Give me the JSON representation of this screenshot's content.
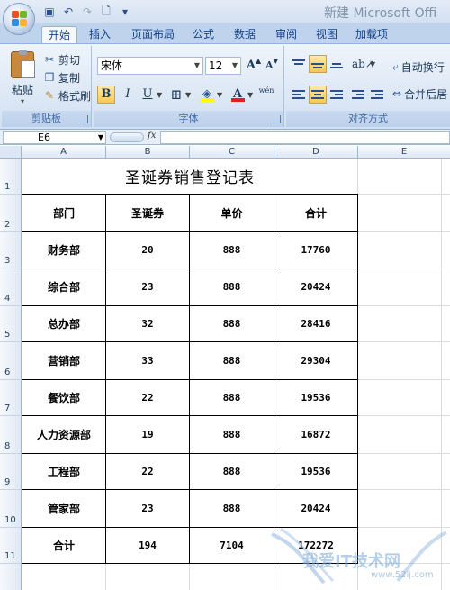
{
  "window": {
    "title": "新建 Microsoft Offi",
    "qat": [
      {
        "icon": "save-icon",
        "glyph": "▣"
      },
      {
        "icon": "undo-icon",
        "glyph": "↶"
      },
      {
        "icon": "redo-icon",
        "glyph": "↷"
      },
      {
        "icon": "print-preview-icon",
        "glyph": "🗋"
      },
      {
        "icon": "customize-qat-icon",
        "glyph": "▾"
      }
    ]
  },
  "ribbon": {
    "tabs": [
      "开始",
      "插入",
      "页面布局",
      "公式",
      "数据",
      "审阅",
      "视图",
      "加载项"
    ],
    "active_tab": "开始",
    "clipboard": {
      "paste": "粘贴",
      "cut": "剪切",
      "copy": "复制",
      "format_painter": "格式刷",
      "group_label": "剪贴板"
    },
    "font": {
      "name": "宋体",
      "size": "12",
      "grow": "A",
      "shrink": "A",
      "bold": "B",
      "italic": "I",
      "underline": "U",
      "font_color_letter": "A",
      "phonetic": "wén",
      "group_label": "字体"
    },
    "alignment": {
      "wrap_text": "自动换行",
      "merge_center": "合并后居",
      "group_label": "对齐方式"
    }
  },
  "formula_bar": {
    "name_box": "E6",
    "fx": "fx",
    "formula": ""
  },
  "grid": {
    "columns": [
      "A",
      "B",
      "C",
      "D",
      "E"
    ],
    "rows": [
      "1",
      "2",
      "3",
      "4",
      "5",
      "6",
      "7",
      "8",
      "9",
      "10",
      "11"
    ]
  },
  "table": {
    "title": "圣诞券销售登记表",
    "headers": [
      "部门",
      "圣诞券",
      "单价",
      "合计"
    ],
    "rows": [
      [
        "财务部",
        "20",
        "888",
        "17760"
      ],
      [
        "综合部",
        "23",
        "888",
        "20424"
      ],
      [
        "总办部",
        "32",
        "888",
        "28416"
      ],
      [
        "营销部",
        "33",
        "888",
        "29304"
      ],
      [
        "餐饮部",
        "22",
        "888",
        "19536"
      ],
      [
        "人力资源部",
        "19",
        "888",
        "16872"
      ],
      [
        "工程部",
        "22",
        "888",
        "19536"
      ],
      [
        "管家部",
        "23",
        "888",
        "20424"
      ],
      [
        "合计",
        "194",
        "7104",
        "172272"
      ]
    ]
  },
  "watermark": {
    "text": "我爱IT技术网",
    "url": "www.52ij.com"
  }
}
